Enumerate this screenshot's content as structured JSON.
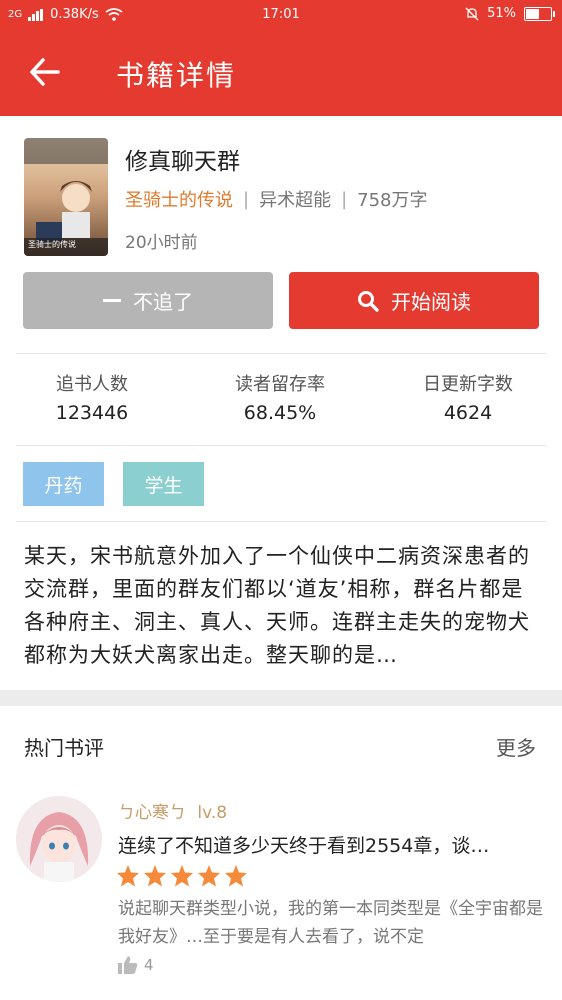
{
  "status_bar": {
    "signal": "2G",
    "network_speed": "0.38K/s",
    "time": "17:01",
    "battery_percent": "51%",
    "battery_level": 0.51
  },
  "header": {
    "title": "书籍详情",
    "back_icon": "arrow-left-icon"
  },
  "book": {
    "title": "修真聊天群",
    "author": "圣骑士的传说",
    "category": "异术超能",
    "word_count": "758万字",
    "updated": "20小时前",
    "cover_text": "圣骑士的传说"
  },
  "actions": {
    "unfollow_label": "不追了",
    "read_label": "开始阅读",
    "read_icon": "search-icon"
  },
  "stats": [
    {
      "label": "追书人数",
      "value": "123446"
    },
    {
      "label": "读者留存率",
      "value": "68.45%"
    },
    {
      "label": "日更新字数",
      "value": "4624"
    }
  ],
  "tags": [
    {
      "label": "丹药",
      "color": "#8fc4ec"
    },
    {
      "label": "学生",
      "color": "#8ccfd1"
    }
  ],
  "synopsis": "某天，宋书航意外加入了一个仙侠中二病资深患者的交流群，里面的群友们都以‘道友’相称，群名片都是各种府主、洞主、真人、天师。连群主走失的宠物犬都称为大妖犬离家出走。整天聊的是…",
  "hot_reviews": {
    "title": "热门书评",
    "more": "更多",
    "items": [
      {
        "user": "ㄅ心寒ㄅ",
        "level": "lv.8",
        "title": "连续了不知道多少天终于看到2554章，谈…",
        "rating": 5,
        "body": "说起聊天群类型小说，我的第一本同类型是《全宇宙都是我好友》…至于要是有人去看了，说不定",
        "likes": "4"
      }
    ]
  },
  "colors": {
    "primary": "#e53a2f",
    "author": "#e07b2c",
    "star": "#f58a3b",
    "button_disabled": "#b5b5b5"
  }
}
